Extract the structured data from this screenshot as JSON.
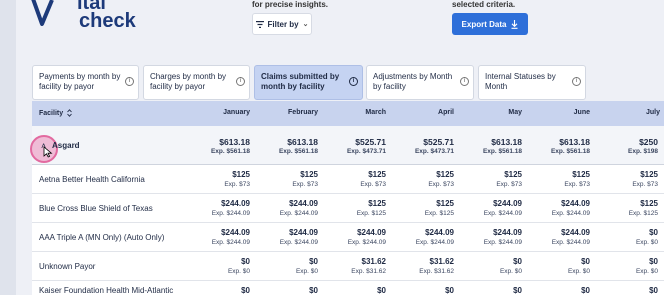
{
  "brand": {
    "logo_line1": "ital",
    "logo_line2": "check",
    "logo_v_color": "#1d3a7a"
  },
  "hints": {
    "filter_hint": "for precise insights.",
    "export_hint": "selected criteria."
  },
  "toolbar": {
    "filter_label": "Filter by",
    "export_label": "Export Data",
    "accent": "#2e6fd9"
  },
  "tabs": [
    {
      "line1": "Payments by month by",
      "line2": "facility by payor",
      "active": false
    },
    {
      "line1": "Charges by month by",
      "line2": "facility by payor",
      "active": false
    },
    {
      "line1": "Claims submitted by",
      "line2": "month by facility",
      "active": true
    },
    {
      "line1": "Adjustments by Month",
      "line2": "by facility",
      "active": false
    },
    {
      "line1": "Internal Statuses by",
      "line2": "Month",
      "active": false
    }
  ],
  "table": {
    "facility_header": "Facility",
    "months": [
      "January",
      "February",
      "March",
      "April",
      "May",
      "June",
      "July"
    ],
    "group": {
      "label": "Asgard",
      "values": [
        {
          "amt": "$613.18",
          "exp": "Exp. $561.18"
        },
        {
          "amt": "$613.18",
          "exp": "Exp. $561.18"
        },
        {
          "amt": "$525.71",
          "exp": "Exp. $473.71"
        },
        {
          "amt": "$525.71",
          "exp": "Exp. $473.71"
        },
        {
          "amt": "$613.18",
          "exp": "Exp. $561.18"
        },
        {
          "amt": "$613.18",
          "exp": "Exp. $561.18"
        },
        {
          "amt": "$250",
          "exp": "Exp. $198"
        }
      ]
    },
    "rows": [
      {
        "label": "Aetna Better Health California",
        "values": [
          {
            "amt": "$125",
            "exp": "Exp. $73"
          },
          {
            "amt": "$125",
            "exp": "Exp. $73"
          },
          {
            "amt": "$125",
            "exp": "Exp. $73"
          },
          {
            "amt": "$125",
            "exp": "Exp. $73"
          },
          {
            "amt": "$125",
            "exp": "Exp. $73"
          },
          {
            "amt": "$125",
            "exp": "Exp. $73"
          },
          {
            "amt": "$125",
            "exp": "Exp. $73"
          }
        ]
      },
      {
        "label": "Blue Cross Blue Shield of Texas",
        "values": [
          {
            "amt": "$244.09",
            "exp": "Exp. $244.09"
          },
          {
            "amt": "$244.09",
            "exp": "Exp. $244.09"
          },
          {
            "amt": "$125",
            "exp": "Exp. $125"
          },
          {
            "amt": "$125",
            "exp": "Exp. $125"
          },
          {
            "amt": "$244.09",
            "exp": "Exp. $244.09"
          },
          {
            "amt": "$244.09",
            "exp": "Exp. $244.09"
          },
          {
            "amt": "$125",
            "exp": "Exp. $125"
          }
        ]
      },
      {
        "label": "AAA Triple A (MN Only) (Auto Only)",
        "values": [
          {
            "amt": "$244.09",
            "exp": "Exp. $244.09"
          },
          {
            "amt": "$244.09",
            "exp": "Exp. $244.09"
          },
          {
            "amt": "$244.09",
            "exp": "Exp. $244.09"
          },
          {
            "amt": "$244.09",
            "exp": "Exp. $244.09"
          },
          {
            "amt": "$244.09",
            "exp": "Exp. $244.09"
          },
          {
            "amt": "$244.09",
            "exp": "Exp. $244.09"
          },
          {
            "amt": "$0",
            "exp": "Exp. $0"
          }
        ]
      },
      {
        "label": "Unknown Payor",
        "values": [
          {
            "amt": "$0",
            "exp": "Exp. $0"
          },
          {
            "amt": "$0",
            "exp": "Exp. $0"
          },
          {
            "amt": "$31.62",
            "exp": "Exp. $31.62"
          },
          {
            "amt": "$31.62",
            "exp": "Exp. $31.62"
          },
          {
            "amt": "$0",
            "exp": "Exp. $0"
          },
          {
            "amt": "$0",
            "exp": "Exp. $0"
          },
          {
            "amt": "$0",
            "exp": "Exp. $0"
          }
        ]
      },
      {
        "label": "Kaiser Foundation Health Mid-Atlantic",
        "values": [
          {
            "amt": "$0",
            "exp": ""
          },
          {
            "amt": "$0",
            "exp": ""
          },
          {
            "amt": "$0",
            "exp": ""
          },
          {
            "amt": "$0",
            "exp": ""
          },
          {
            "amt": "$0",
            "exp": ""
          },
          {
            "amt": "$0",
            "exp": ""
          },
          {
            "amt": "$0",
            "exp": ""
          }
        ]
      }
    ]
  }
}
